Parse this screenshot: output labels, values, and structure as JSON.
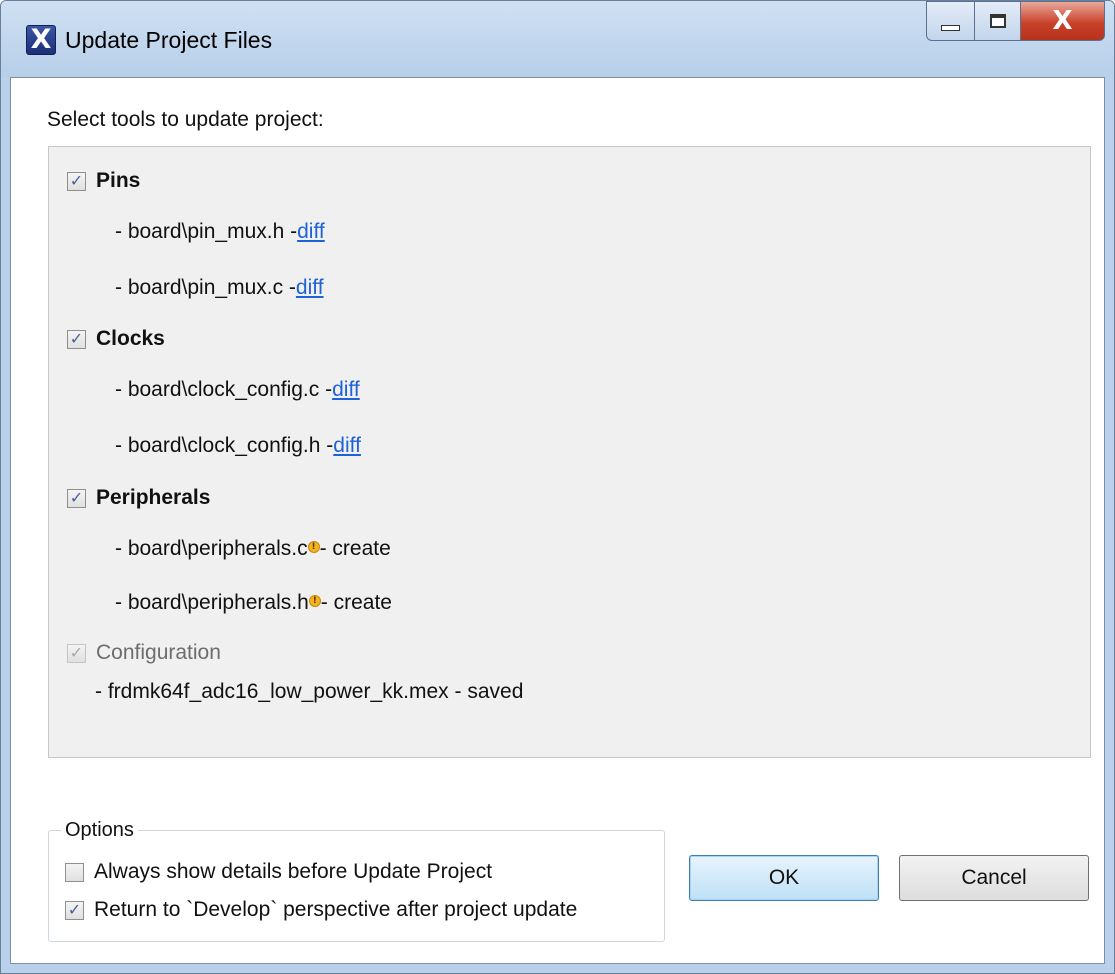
{
  "window": {
    "title": "Update Project Files",
    "app_icon_glyph": "X",
    "controls": {
      "close_glyph": "X"
    }
  },
  "prompt": "Select tools to update project:",
  "tools": {
    "pins": {
      "label": "Pins",
      "checked": true
    },
    "pins_files": [
      {
        "prefix": "- board\\pin_mux.h - ",
        "link": "diff"
      },
      {
        "prefix": "- board\\pin_mux.c - ",
        "link": "diff"
      }
    ],
    "clocks": {
      "label": "Clocks",
      "checked": true
    },
    "clocks_files": [
      {
        "prefix": "- board\\clock_config.c - ",
        "link": "diff"
      },
      {
        "prefix": "- board\\clock_config.h - ",
        "link": "diff"
      }
    ],
    "peripherals": {
      "label": "Peripherals",
      "checked": true
    },
    "peripherals_files": [
      {
        "name": "- board\\peripherals.c",
        "action": "- create",
        "warning": "!"
      },
      {
        "name": "- board\\peripherals.h",
        "action": "- create",
        "warning": "!"
      }
    ],
    "configuration": {
      "label": "Configuration",
      "checked": true,
      "disabled": true
    },
    "configuration_file": "- frdmk64f_adc16_low_power_kk.mex - saved"
  },
  "options": {
    "title": "Options",
    "always_show": {
      "label": "Always show details before Update Project",
      "checked": false
    },
    "return_develop": {
      "label": "Return to `Develop` perspective after project update",
      "checked": true
    }
  },
  "buttons": {
    "ok": "OK",
    "cancel": "Cancel"
  },
  "check_glyph": "✓",
  "colors": {
    "link": "#1d62d6",
    "close_button": "#c9432c",
    "warning": "#f4b321"
  }
}
